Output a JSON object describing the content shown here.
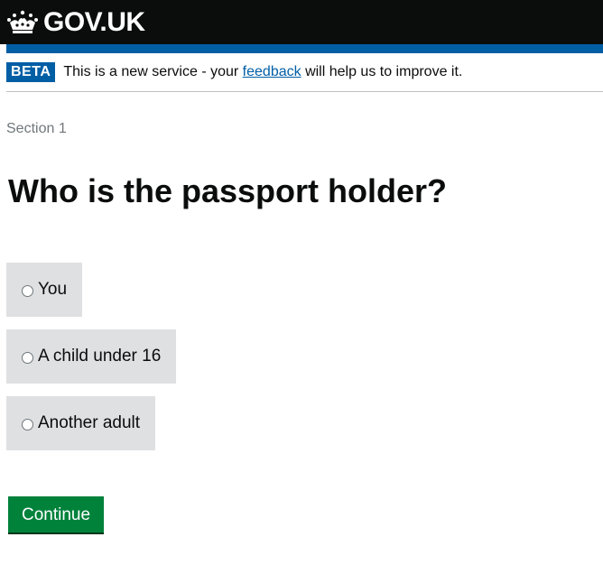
{
  "header": {
    "logo_text": "GOV.UK",
    "logo_icon": "crown-icon"
  },
  "phase_banner": {
    "tag": "BETA",
    "text_before": "This is a new service - your",
    "link_text": "feedback",
    "text_after": "will help us to improve it."
  },
  "main": {
    "caption": "Section 1",
    "heading": "Who is the passport holder?",
    "options": [
      {
        "label": "You"
      },
      {
        "label": "A child under 16"
      },
      {
        "label": "Another adult"
      }
    ],
    "continue_label": "Continue"
  },
  "colors": {
    "header_bg": "#0b0c0c",
    "brand_blue": "#005ea5",
    "option_bg": "#dee0e2",
    "button_green": "#00823b",
    "caption_grey": "#6f777b"
  }
}
